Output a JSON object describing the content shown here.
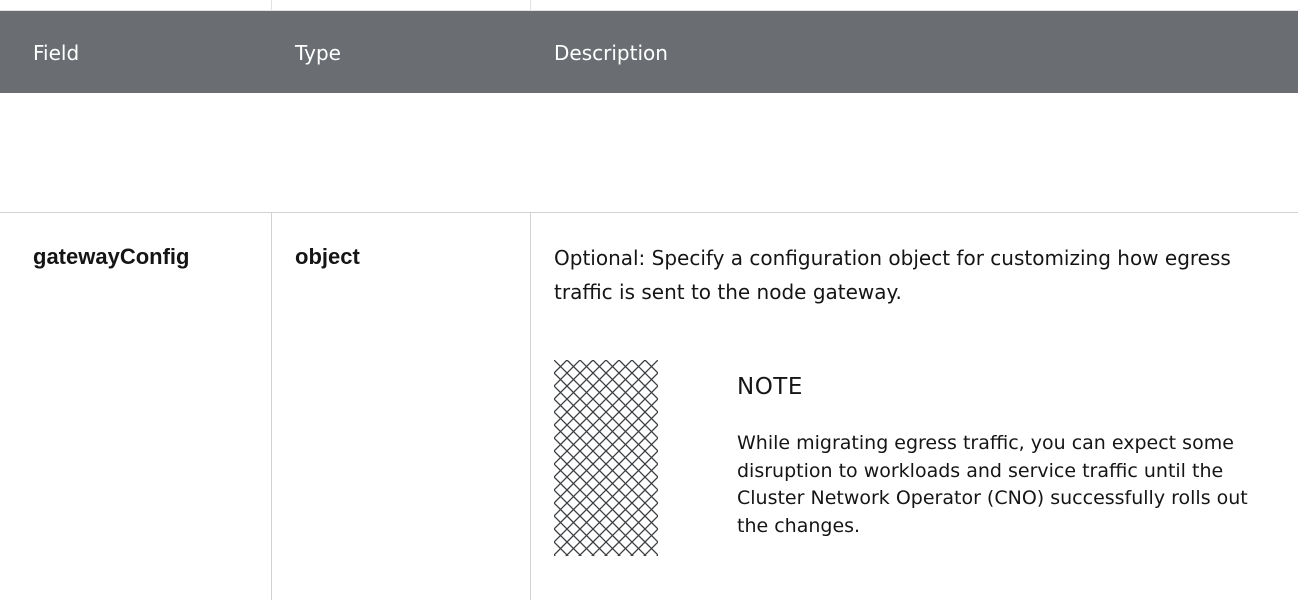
{
  "header": {
    "columns": [
      "Field",
      "Type",
      "Description"
    ]
  },
  "row": {
    "field": "gatewayConfig",
    "type": "object",
    "description": "Optional: Specify a configuration object for customizing how egress traffic is sent to the node gateway."
  },
  "note": {
    "icon": "note-pattern-icon",
    "title": "NOTE",
    "text": "While migrating egress traffic, you can expect some disruption to workloads and service traffic until the Cluster Network Operator (CNO) successfully rolls out the changes."
  },
  "colors": {
    "header_bg": "#6a6e73",
    "header_text": "#ffffff",
    "border": "#d2d2d2",
    "text": "#151515"
  }
}
